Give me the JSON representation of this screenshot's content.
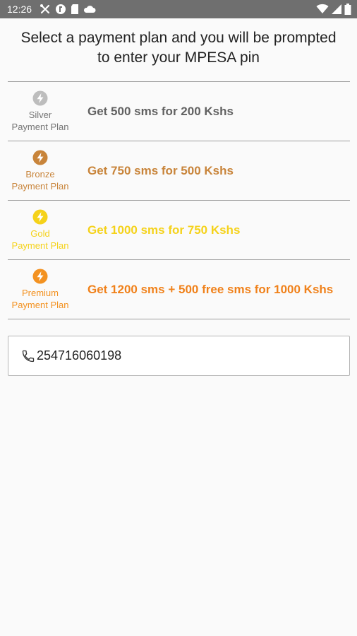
{
  "status_bar": {
    "time": "12:26",
    "background": "#6f6f6f",
    "left_icons": [
      "tools-icon",
      "blocked-circle-icon",
      "sd-card-icon",
      "cloud-icon"
    ],
    "right_icons": [
      "wifi-icon",
      "signal-icon",
      "battery-icon"
    ]
  },
  "header": {
    "line1": "Select a payment plan and you will be prompted",
    "line2": "to enter your MPESA pin"
  },
  "plans": [
    {
      "name_line1": "Silver",
      "name_line2": "Payment Plan",
      "offer": "Get 500 sms for 200 Kshs",
      "color": "#bdbdbd",
      "text_color": "#757575",
      "offer_color": "#616161",
      "icon": "lightning-bolt-icon"
    },
    {
      "name_line1": "Bronze",
      "name_line2": "Payment Plan",
      "offer": "Get 750 sms for 500 Kshs",
      "color": "#c8843a",
      "text_color": "#c8843a",
      "offer_color": "#c8843a",
      "icon": "lightning-bolt-icon"
    },
    {
      "name_line1": "Gold",
      "name_line2": "Payment Plan",
      "offer": "Get 1000 sms for 750 Kshs",
      "color": "#f5d21a",
      "text_color": "#f5d21a",
      "offer_color": "#f5d21a",
      "icon": "lightning-bolt-icon"
    },
    {
      "name_line1": "Premium",
      "name_line2": "Payment Plan",
      "offer": "Get 1200 sms + 500 free sms for 1000 Kshs",
      "color": "#f39221",
      "text_color": "#f39221",
      "offer_color": "#f0811a",
      "icon": "lightning-bolt-icon"
    }
  ],
  "phone_input": {
    "value": "254716060198",
    "icon": "phone-icon"
  }
}
